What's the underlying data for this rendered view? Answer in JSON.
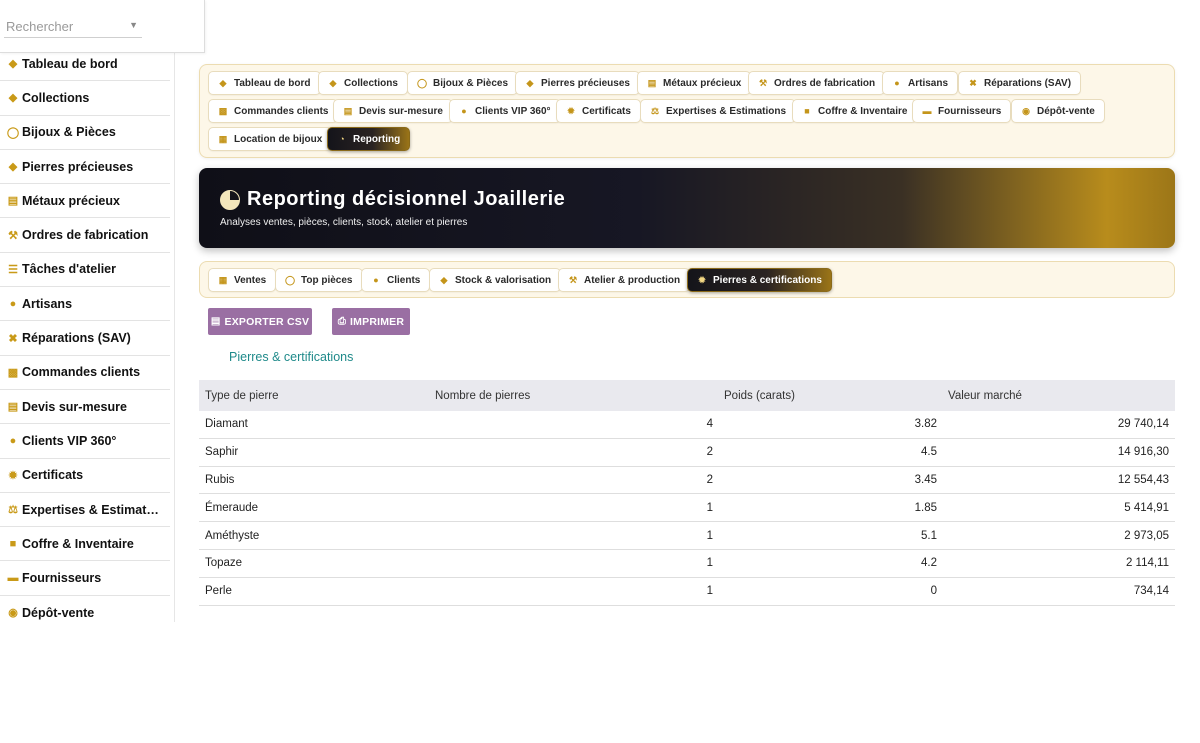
{
  "search": {
    "placeholder": "Rechercher"
  },
  "sidebar": {
    "items": [
      {
        "label": "Tableau de bord",
        "icon": "gem-icon"
      },
      {
        "label": "Collections",
        "icon": "gem-icon"
      },
      {
        "label": "Bijoux & Pièces",
        "icon": "ring-icon"
      },
      {
        "label": "Pierres précieuses",
        "icon": "gem-icon"
      },
      {
        "label": "Métaux précieux",
        "icon": "coins-icon"
      },
      {
        "label": "Ordres de fabrication",
        "icon": "hammer-icon"
      },
      {
        "label": "Tâches d'atelier",
        "icon": "list-icon"
      },
      {
        "label": "Artisans",
        "icon": "users-icon"
      },
      {
        "label": "Réparations (SAV)",
        "icon": "tools-icon"
      },
      {
        "label": "Commandes clients",
        "icon": "cart-icon"
      },
      {
        "label": "Devis sur-mesure",
        "icon": "document-icon"
      },
      {
        "label": "Clients VIP 360°",
        "icon": "user-icon"
      },
      {
        "label": "Certificats",
        "icon": "certificate-icon"
      },
      {
        "label": "Expertises & Estimat…",
        "icon": "scale-icon"
      },
      {
        "label": "Coffre & Inventaire",
        "icon": "lock-icon"
      },
      {
        "label": "Fournisseurs",
        "icon": "truck-icon"
      },
      {
        "label": "Dépôt-vente",
        "icon": "handshake-icon"
      }
    ]
  },
  "topnav": {
    "items": [
      {
        "label": "Tableau de bord",
        "icon": "gem-icon"
      },
      {
        "label": "Collections",
        "icon": "gem-icon"
      },
      {
        "label": "Bijoux & Pièces",
        "icon": "ring-icon"
      },
      {
        "label": "Pierres précieuses",
        "icon": "gem-icon"
      },
      {
        "label": "Métaux précieux",
        "icon": "coins-icon"
      },
      {
        "label": "Ordres de fabrication",
        "icon": "hammer-icon"
      },
      {
        "label": "Artisans",
        "icon": "users-icon"
      },
      {
        "label": "Réparations (SAV)",
        "icon": "tools-icon"
      },
      {
        "label": "Commandes clients",
        "icon": "cart-icon"
      },
      {
        "label": "Devis sur-mesure",
        "icon": "document-icon"
      },
      {
        "label": "Clients VIP 360°",
        "icon": "user-icon"
      },
      {
        "label": "Certificats",
        "icon": "certificate-icon"
      },
      {
        "label": "Expertises & Estimations",
        "icon": "scale-icon"
      },
      {
        "label": "Coffre & Inventaire",
        "icon": "lock-icon"
      },
      {
        "label": "Fournisseurs",
        "icon": "truck-icon"
      },
      {
        "label": "Dépôt-vente",
        "icon": "handshake-icon"
      },
      {
        "label": "Location de bijoux",
        "icon": "calendar-icon"
      },
      {
        "label": "Reporting",
        "icon": "pie-chart-icon",
        "active": true
      }
    ]
  },
  "banner": {
    "title": "Reporting décisionnel Joaillerie",
    "subtitle": "Analyses ventes, pièces, clients, stock, atelier et pierres"
  },
  "subtabs": {
    "items": [
      {
        "label": "Ventes",
        "icon": "line-chart-icon"
      },
      {
        "label": "Top pièces",
        "icon": "ring-icon"
      },
      {
        "label": "Clients",
        "icon": "user-icon"
      },
      {
        "label": "Stock & valorisation",
        "icon": "gem-icon"
      },
      {
        "label": "Atelier & production",
        "icon": "hammer-icon"
      },
      {
        "label": "Pierres & certifications",
        "icon": "certificate-icon",
        "active": true
      }
    ]
  },
  "actions": {
    "export_label": "EXPORTER CSV",
    "print_label": "IMPRIMER"
  },
  "section": {
    "title": "Pierres & certifications"
  },
  "table": {
    "headers": [
      "Type de pierre",
      "Nombre de pierres",
      "Poids (carats)",
      "Valeur marché"
    ],
    "rows": [
      [
        "Diamant",
        "4",
        "3.82",
        "29 740,14"
      ],
      [
        "Saphir",
        "2",
        "4.5",
        "14 916,30"
      ],
      [
        "Rubis",
        "2",
        "3.45",
        "12 554,43"
      ],
      [
        "Émeraude",
        "1",
        "1.85",
        "5 414,91"
      ],
      [
        "Améthyste",
        "1",
        "5.1",
        "2 973,05"
      ],
      [
        "Topaze",
        "1",
        "4.2",
        "2 114,11"
      ],
      [
        "Perle",
        "1",
        "0",
        "734,14"
      ]
    ]
  },
  "colors": {
    "accent_gold": "#c4951a",
    "button_purple": "#9a6fa3",
    "section_teal": "#1f8a8a",
    "banner_dark": "#0f0f17"
  }
}
